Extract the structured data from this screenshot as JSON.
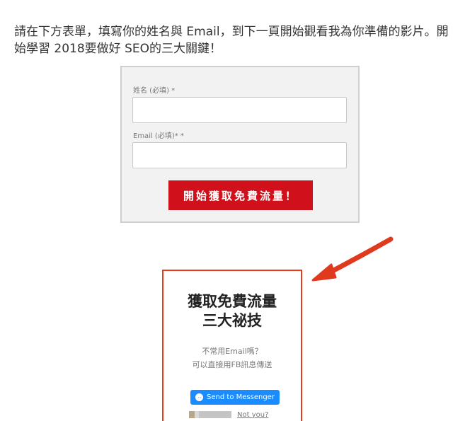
{
  "intro": {
    "text": "請在下方表單，填寫你的姓名與 Email，到下一頁開始觀看我為你準備的影片。開始學習 2018要做好 SEO的三大關鍵！"
  },
  "form": {
    "name_label": "姓名 (必填) *",
    "name_value": "",
    "email_label": "Email (必填)* *",
    "email_value": "",
    "submit_label": "開始獲取免費流量！"
  },
  "preview": {
    "title_line1": "獲取免費流量",
    "title_line2": "三大祕技",
    "sub_line1": "不常用Email嗎？",
    "sub_line2": "可以直接用FB訊息傳送",
    "messenger_label": "Send to Messenger",
    "not_you": "Not you?"
  },
  "icons": {
    "arrow": "arrow-pointing-left-icon",
    "messenger": "messenger-icon"
  },
  "colors": {
    "submit_button": "#d0111b",
    "preview_border": "#e8391b",
    "messenger_button": "#1a8cff",
    "arrow": "#e03a1e"
  }
}
